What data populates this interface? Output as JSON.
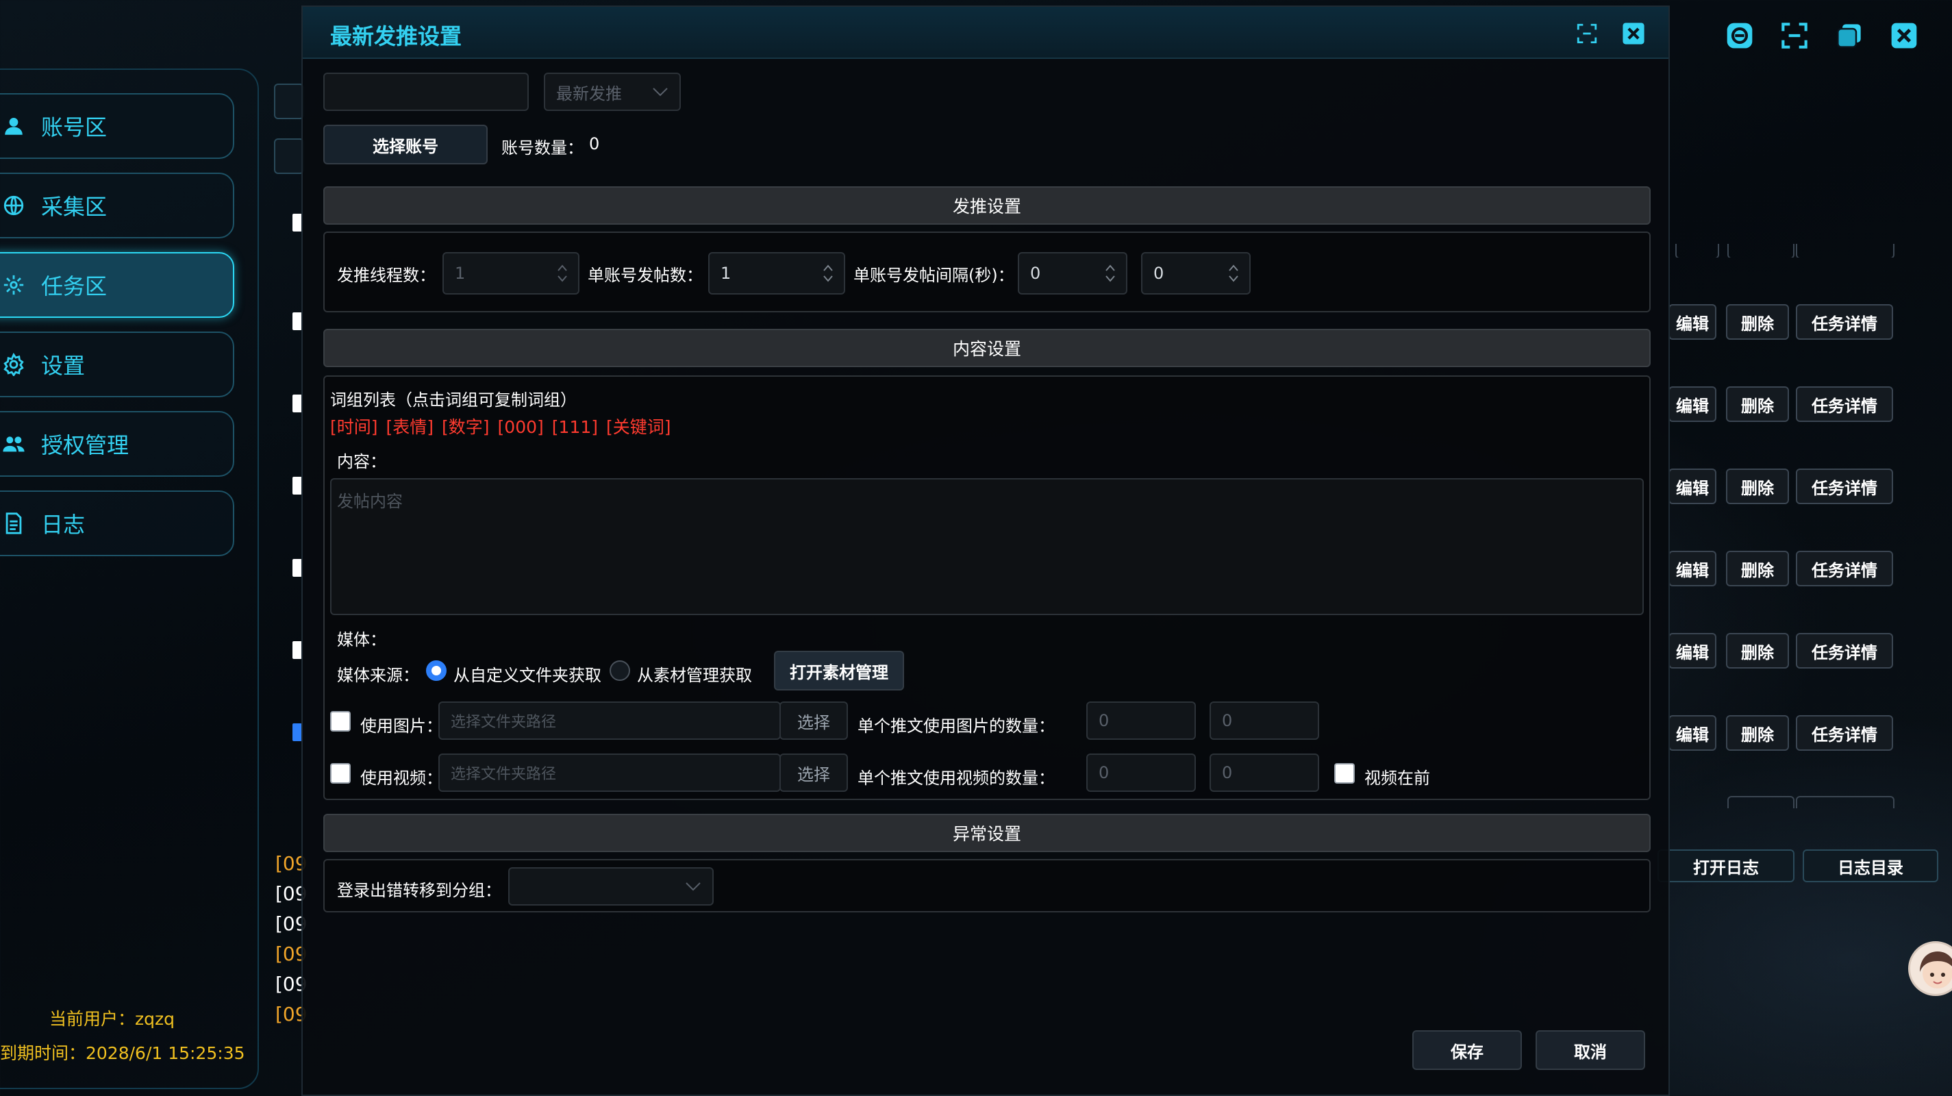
{
  "sidebar": {
    "items": [
      {
        "label": "账号区",
        "icon": "user-icon"
      },
      {
        "label": "采集区",
        "icon": "globe-icon"
      },
      {
        "label": "任务区",
        "icon": "task-icon"
      },
      {
        "label": "设置",
        "icon": "gear-icon"
      },
      {
        "label": "授权管理",
        "icon": "users-icon"
      },
      {
        "label": "日志",
        "icon": "document-icon"
      }
    ],
    "current_user": "当前用户：zqzq",
    "expire_time": "到期时间：2028/6/1 15:25:35"
  },
  "window_controls": [
    "chat-icon",
    "fullscreen-icon",
    "restore-icon",
    "close-icon"
  ],
  "task_table": {
    "edit_label": "编辑",
    "delete_label": "删除",
    "detail_label": "任务详情"
  },
  "log_buttons": {
    "open_log": "打开日志",
    "log_dir": "日志目录"
  },
  "log_lines": [
    "[09",
    "[09",
    "[09",
    "[09",
    "[09",
    "[09"
  ],
  "dialog": {
    "title": "最新发推设置",
    "name_input_value": "",
    "type_select": "最新发推",
    "select_account": "选择账号",
    "account_count_label": "账号数量：",
    "account_count": "0",
    "section_send": "发推设置",
    "threads_label": "发推线程数：",
    "threads_value": "1",
    "posts_label": "单账号发帖数：",
    "posts_value": "1",
    "interval_label": "单账号发帖间隔(秒)：",
    "interval_min": "0",
    "interval_max": "0",
    "section_content": "内容设置",
    "wordgroup_label": "词组列表（点击词组可复制词组）",
    "wordgroups": [
      "[时间]",
      "[表情]",
      "[数字]",
      "[000]",
      "[111]",
      "[关键词]"
    ],
    "content_label": "内容：",
    "content_placeholder": "发帖内容",
    "media_label": "媒体：",
    "media_source_label": "媒体来源：",
    "media_option_custom": "从自定义文件夹获取",
    "media_option_library": "从素材管理获取",
    "media_selected": "从自定义文件夹获取",
    "open_library": "打开素材管理",
    "use_image_label": "使用图片：",
    "image_path_placeholder": "选择文件夹路径",
    "choose_label": "选择",
    "image_count_label": "单个推文使用图片的数量：",
    "image_min": "0",
    "image_max": "0",
    "use_video_label": "使用视频：",
    "video_path_placeholder": "选择文件夹路径",
    "video_count_label": "单个推文使用视频的数量：",
    "video_min": "0",
    "video_max": "0",
    "video_first_label": "视频在前",
    "section_error": "异常设置",
    "login_error_label": "登录出错转移到分组：",
    "login_error_group": "",
    "save": "保存",
    "cancel": "取消"
  },
  "colors": {
    "accent": "#33d0f0",
    "warning": "#f0a52a",
    "tag": "#ff3b2f",
    "radio_selected": "#2d7ff9"
  }
}
